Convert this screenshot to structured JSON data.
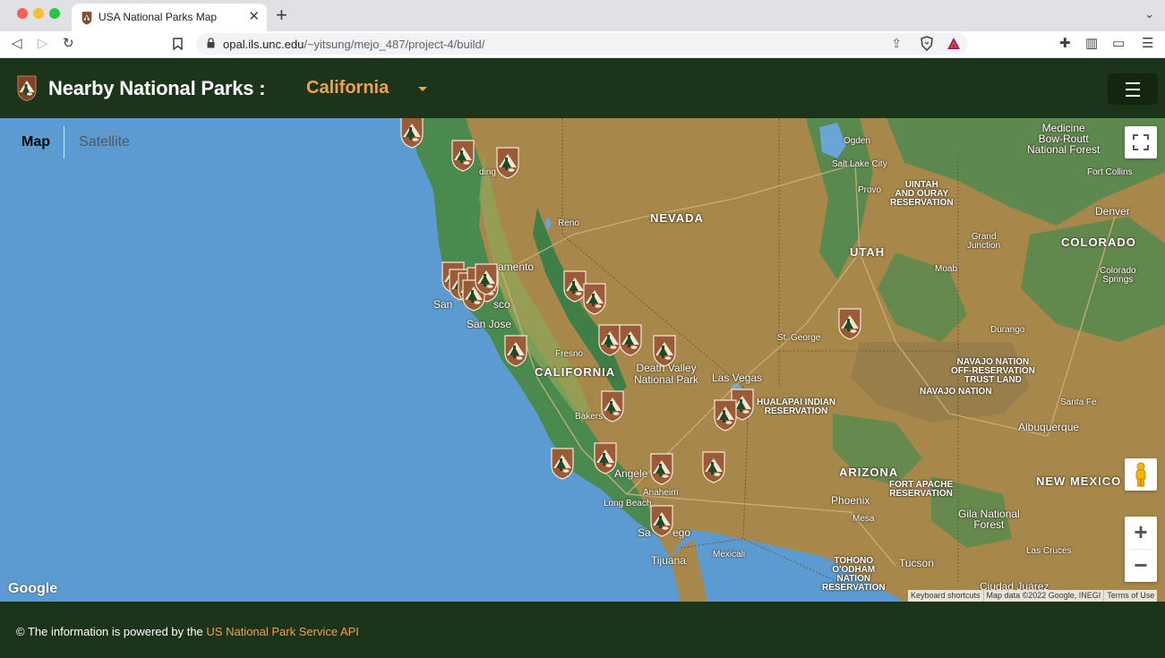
{
  "browser": {
    "tab_title": "USA National Parks Map",
    "tab_close": "✕",
    "new_tab": "+",
    "url_host": "opal.ils.unc.edu",
    "url_path": "/~yitsung/mejo_487/project-4/build/"
  },
  "header": {
    "title": "Nearby National Parks :",
    "selected_state": "California"
  },
  "map": {
    "type_buttons": {
      "map": "Map",
      "satellite": "Satellite"
    },
    "zoom_in": "+",
    "zoom_out": "−",
    "google_logo": "Google",
    "attribution": {
      "shortcuts": "Keyboard shortcuts",
      "data": "Map data ©2022 Google, INEGI",
      "terms": "Terms of Use"
    },
    "labels": {
      "nevada": "NEVADA",
      "utah": "UTAH",
      "colorado": "COLORADO",
      "california": "CALIFORNIA",
      "arizona": "ARIZONA",
      "new_mexico": "NEW MEXICO",
      "ogden": "Ogden",
      "salt_lake_city": "Salt Lake City",
      "provo": "Provo",
      "uintah_1": "UINTAH",
      "uintah_2": "AND OURAY",
      "uintah_3": "RESERVATION",
      "medicine_1": "Medicine",
      "medicine_2": "Bow-Routt",
      "medicine_3": "National Forest",
      "fort_collins": "Fort Collins",
      "denver": "Denver",
      "grand_junction_1": "Grand",
      "grand_junction_2": "Junction",
      "moab": "Moab",
      "colorado_springs_1": "Colorado",
      "colorado_springs_2": "Springs",
      "reno": "Reno",
      "sacramento": "amento",
      "redding": "ding",
      "san_francisco_a": "San",
      "san_francisco_b": "sco",
      "san_jose": "San Jose",
      "fresno": "Fresno",
      "death_valley_1": "Death Valley",
      "death_valley_2": "National Park",
      "las_vegas": "Las Vegas",
      "st_george": "St. George",
      "durango": "Durango",
      "navajo_off_1": "NAVAJO NATION",
      "navajo_off_2": "OFF-RESERVATION",
      "navajo_off_3": "TRUST LAND",
      "navajo_nation": "NAVAJO NATION",
      "santa_fe": "Santa Fe",
      "hualapai_1": "HUALAPAI INDIAN",
      "hualapai_2": "RESERVATION",
      "bakersfield": "Bakers",
      "albuquerque": "Albuquerque",
      "los_angeles": "Angele",
      "anaheim": "Anaheim",
      "long_beach": "Long Beach",
      "fort_apache_1": "FORT APACHE",
      "fort_apache_2": "RESERVATION",
      "phoenix": "Phoenix",
      "mesa": "Mesa",
      "gila_1": "Gila National",
      "gila_2": "Forest",
      "san_diego_a": "Sa",
      "san_diego_b": "ego",
      "tijuana": "Tijuana",
      "mexicali": "Mexicali",
      "tohono_1": "TOHONO",
      "tohono_2": "O'ODHAM",
      "tohono_3": "NATION",
      "tohono_4": "RESERVATION",
      "tucson": "Tucson",
      "las_cruces": "Las Cruces",
      "ciudad_juarez": "Ciudad Juárez"
    }
  },
  "footer": {
    "prefix": "© The information is powered by the ",
    "link": "US National Park Service API"
  },
  "colors": {
    "header_bg": "#1c3419",
    "accent": "#f0a050",
    "ocean": "#5b9bd1",
    "land": "#a8884a",
    "forest": "#4a8a4f",
    "nps_badge": "#9b5a38"
  }
}
